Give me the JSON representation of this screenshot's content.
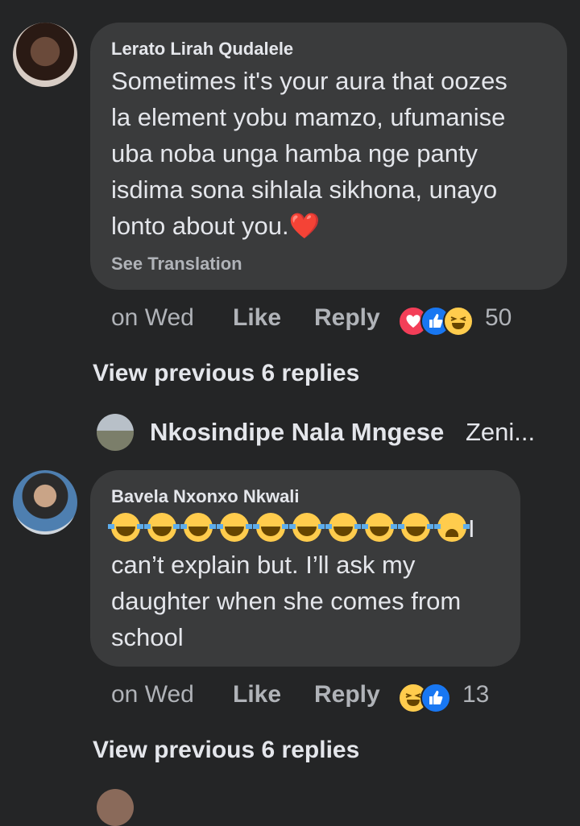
{
  "comments": [
    {
      "author": "Lerato Lirah Qudalele",
      "lines": [
        "Sometimes it's your aura that oozes",
        "la element yobu mamzo, ufumanise",
        "uba noba unga hamba nge panty",
        "isdima sona sihlala sikhona, unayo",
        "lonto about you."
      ],
      "emoji_tail": "❤️",
      "see_translation": "See Translation",
      "time": "on Wed",
      "like": "Like",
      "reply": "Reply",
      "reaction_icons": [
        "heart-reaction",
        "like-reaction",
        "haha-reaction"
      ],
      "reaction_count": "50"
    },
    {
      "author": "Bavela Nxonxo Nkwali",
      "emoji_row_text": "I",
      "lines": [
        "can’t explain but. I’ll ask my",
        "daughter when she comes from",
        "school"
      ],
      "time": "on Wed",
      "like": "Like",
      "reply": "Reply",
      "reaction_icons": [
        "haha-reaction",
        "like-reaction"
      ],
      "reaction_count": "13"
    }
  ],
  "view_previous_1": "View previous 6 replies",
  "view_previous_2": "View previous 6 replies",
  "nested_reply": {
    "name": "Nkosindipe Nala Mngese",
    "snippet": "Zeni..."
  },
  "colors": {
    "background": "#242526",
    "bubble": "#3a3b3c",
    "text": "#e4e6eb",
    "muted": "#b0b3b8",
    "like_blue": "#1877f2",
    "heart_red": "#f33e58",
    "haha_yellow": "#ffcc4d"
  }
}
